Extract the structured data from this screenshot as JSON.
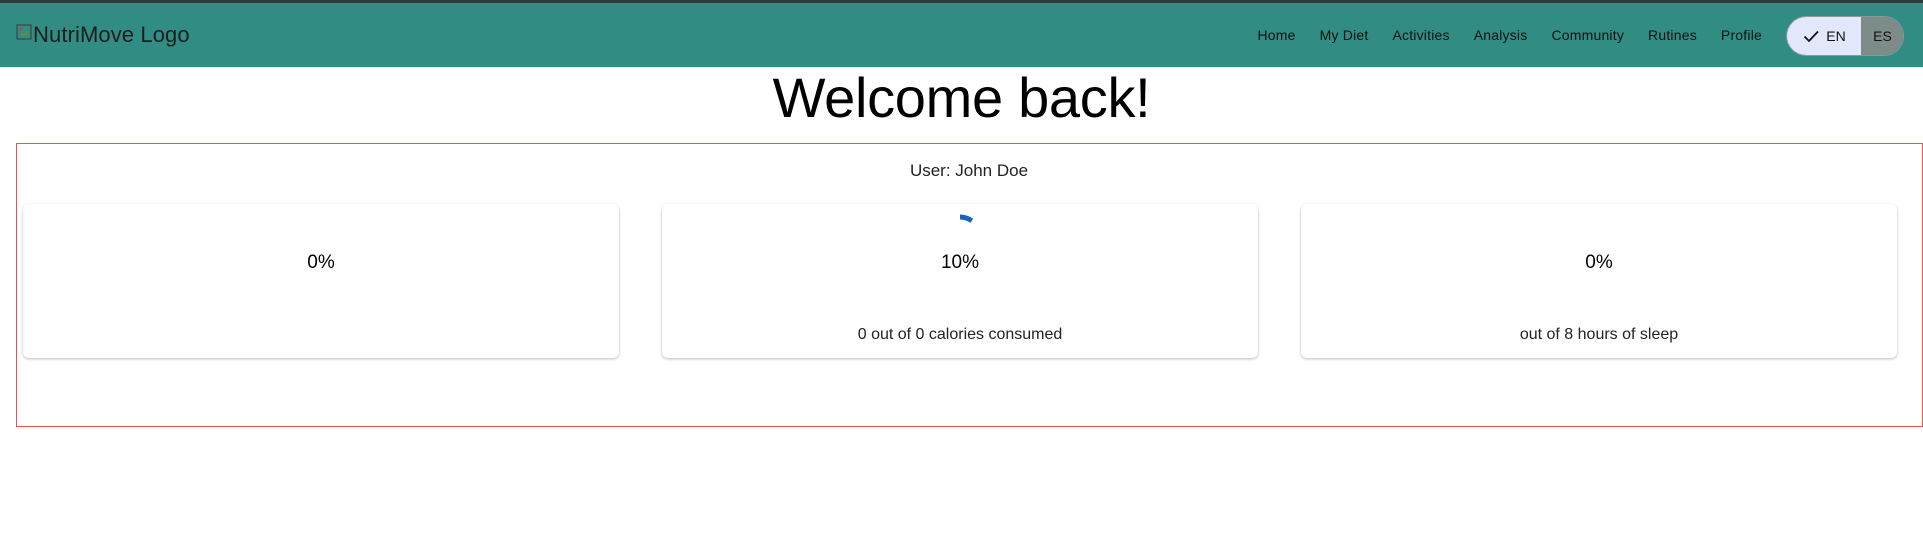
{
  "header": {
    "logo_alt": "NutriMove Logo",
    "nav": [
      {
        "label": "Home"
      },
      {
        "label": "My Diet"
      },
      {
        "label": "Activities"
      },
      {
        "label": "Analysis"
      },
      {
        "label": "Community"
      },
      {
        "label": "Rutines"
      },
      {
        "label": "Profile"
      }
    ],
    "language": {
      "selected": "EN",
      "options": [
        "EN",
        "ES"
      ]
    }
  },
  "main": {
    "title": "Welcome back!",
    "user_line": "User: John Doe",
    "cards": [
      {
        "percent": "0%",
        "caption": ""
      },
      {
        "percent": "10%",
        "caption": "0 out of 0 calories consumed",
        "progress": 0.1
      },
      {
        "percent": "0%",
        "caption": "out of 8 hours of sleep"
      }
    ]
  },
  "colors": {
    "header_bg": "#318c84",
    "frame_border": "#e0535b",
    "progress_arc": "#1565c0",
    "lang_selected_bg": "#e2e7fb",
    "lang_unselected_bg": "#7d8b89"
  }
}
